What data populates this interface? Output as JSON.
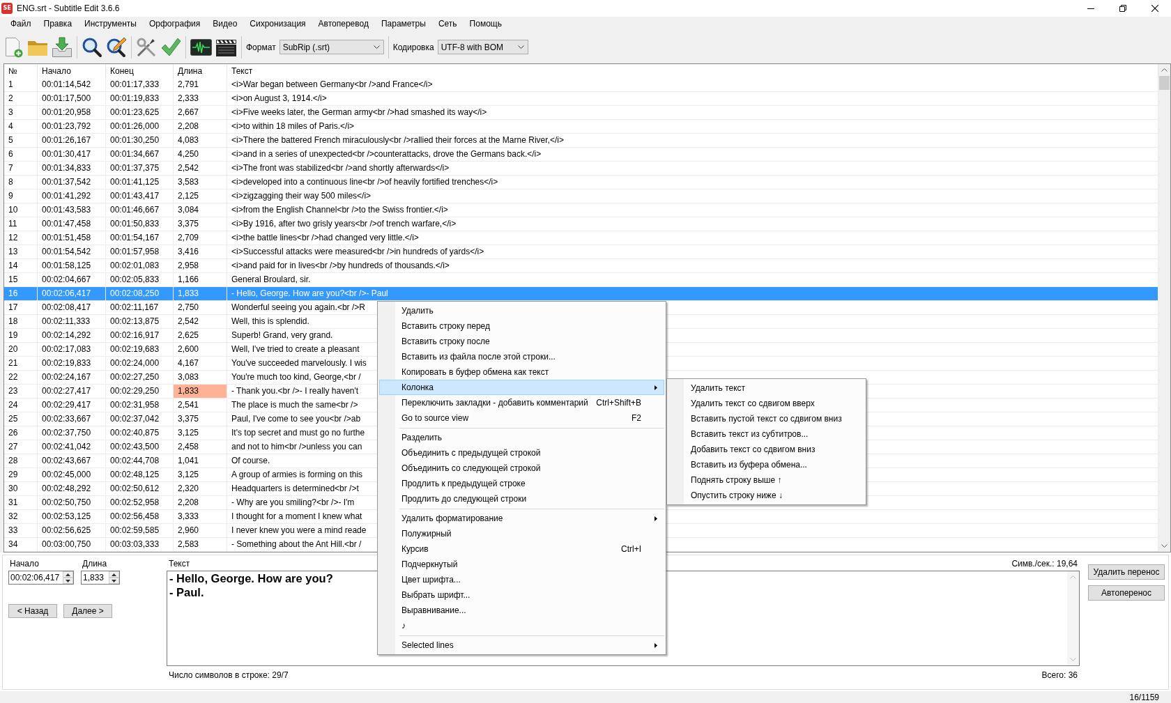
{
  "window": {
    "logo": "SE",
    "title": "ENG.srt - Subtitle Edit 3.6.6"
  },
  "menu_bar": {
    "items": [
      "Файл",
      "Правка",
      "Инструменты",
      "Орфография",
      "Видео",
      "Сихронизация",
      "Автоперевод",
      "Параметры",
      "Сеть",
      "Помощь"
    ]
  },
  "toolbar": {
    "format_label": "Формат",
    "format_value": "SubRip (.srt)",
    "encoding_label": "Кодировка",
    "encoding_value": "UTF-8 with BOM"
  },
  "subtitle_table": {
    "columns": [
      "№",
      "Начало",
      "Конец",
      "Длина",
      "Текст"
    ],
    "rows": [
      {
        "number": "1",
        "start": "00:01:14,542",
        "end": "00:01:17,333",
        "duration": "2,791",
        "text": "<i>War began between Germany<br />and France</i>",
        "selected": false,
        "duration_warning": false
      },
      {
        "number": "2",
        "start": "00:01:17,500",
        "end": "00:01:19,833",
        "duration": "2,333",
        "text": "<i>on August 3, 1914.</i>",
        "selected": false,
        "duration_warning": false
      },
      {
        "number": "3",
        "start": "00:01:20,958",
        "end": "00:01:23,625",
        "duration": "2,667",
        "text": "<i>Five weeks later, the German army<br />had smashed its way</i>",
        "selected": false,
        "duration_warning": false
      },
      {
        "number": "4",
        "start": "00:01:23,792",
        "end": "00:01:26,000",
        "duration": "2,208",
        "text": "<i>to within 18 miles of Paris.</i>",
        "selected": false,
        "duration_warning": false
      },
      {
        "number": "5",
        "start": "00:01:26,167",
        "end": "00:01:30,250",
        "duration": "4,083",
        "text": "<i>There the battered French miraculously<br />rallied their forces at the Marne River,</i>",
        "selected": false,
        "duration_warning": false
      },
      {
        "number": "6",
        "start": "00:01:30,417",
        "end": "00:01:34,667",
        "duration": "4,250",
        "text": "<i>and in a series of unexpected<br />counterattacks, drove the Germans back.</i>",
        "selected": false,
        "duration_warning": false
      },
      {
        "number": "7",
        "start": "00:01:34,833",
        "end": "00:01:37,375",
        "duration": "2,542",
        "text": "<i>The front was stabilized<br />and shortly afterwards</i>",
        "selected": false,
        "duration_warning": false
      },
      {
        "number": "8",
        "start": "00:01:37,542",
        "end": "00:01:41,125",
        "duration": "3,583",
        "text": "<i>developed into a continuous line<br />of heavily fortified trenches</i>",
        "selected": false,
        "duration_warning": false
      },
      {
        "number": "9",
        "start": "00:01:41,292",
        "end": "00:01:43,417",
        "duration": "2,125",
        "text": "<i>zigzagging their way 500 miles</i>",
        "selected": false,
        "duration_warning": false
      },
      {
        "number": "10",
        "start": "00:01:43,583",
        "end": "00:01:46,667",
        "duration": "3,084",
        "text": "<i>from the English Channel<br />to the Swiss frontier.</i>",
        "selected": false,
        "duration_warning": false
      },
      {
        "number": "11",
        "start": "00:01:47,458",
        "end": "00:01:50,833",
        "duration": "3,375",
        "text": "<i>By 1916, after two grisly years<br />of trench warfare,</i>",
        "selected": false,
        "duration_warning": false
      },
      {
        "number": "12",
        "start": "00:01:51,458",
        "end": "00:01:54,167",
        "duration": "2,709",
        "text": "<i>the battle lines<br />had changed very little.</i>",
        "selected": false,
        "duration_warning": false
      },
      {
        "number": "13",
        "start": "00:01:54,542",
        "end": "00:01:57,958",
        "duration": "3,416",
        "text": "<i>Successful attacks were measured<br />in hundreds of yards</i>",
        "selected": false,
        "duration_warning": false
      },
      {
        "number": "14",
        "start": "00:01:58,125",
        "end": "00:02:01,083",
        "duration": "2,958",
        "text": "<i>and paid for in lives<br />by hundreds of thousands.</i>",
        "selected": false,
        "duration_warning": false
      },
      {
        "number": "15",
        "start": "00:02:04,667",
        "end": "00:02:05,833",
        "duration": "1,166",
        "text": "General Broulard, sir.",
        "selected": false,
        "duration_warning": false
      },
      {
        "number": "16",
        "start": "00:02:06,417",
        "end": "00:02:08,250",
        "duration": "1,833",
        "text": "- Hello, George. How are you?<br />- Paul",
        "selected": true,
        "duration_warning": false
      },
      {
        "number": "17",
        "start": "00:02:08,417",
        "end": "00:02:11,167",
        "duration": "2,750",
        "text": "Wonderful seeing you again.<br />R",
        "selected": false,
        "duration_warning": false
      },
      {
        "number": "18",
        "start": "00:02:11,333",
        "end": "00:02:13,875",
        "duration": "2,542",
        "text": "Well, this is splendid.",
        "selected": false,
        "duration_warning": false
      },
      {
        "number": "19",
        "start": "00:02:14,292",
        "end": "00:02:16,917",
        "duration": "2,625",
        "text": "Superb! Grand, very grand.",
        "selected": false,
        "duration_warning": false
      },
      {
        "number": "20",
        "start": "00:02:17,083",
        "end": "00:02:19,683",
        "duration": "2,600",
        "text": "Well, I've tried to create a pleasant",
        "selected": false,
        "duration_warning": false
      },
      {
        "number": "21",
        "start": "00:02:19,833",
        "end": "00:02:24,000",
        "duration": "4,167",
        "text": "You've succeeded marvelously. I wis",
        "selected": false,
        "duration_warning": false
      },
      {
        "number": "22",
        "start": "00:02:24,167",
        "end": "00:02:27,250",
        "duration": "3,083",
        "text": "You're much too kind, George,<br /",
        "selected": false,
        "duration_warning": false
      },
      {
        "number": "23",
        "start": "00:02:27,417",
        "end": "00:02:29,250",
        "duration": "1,833",
        "text": "- Thank you.<br />- I really haven't",
        "selected": false,
        "duration_warning": true
      },
      {
        "number": "24",
        "start": "00:02:29,417",
        "end": "00:02:31,958",
        "duration": "2,541",
        "text": "The place is much the same<br />",
        "selected": false,
        "duration_warning": false
      },
      {
        "number": "25",
        "start": "00:02:33,667",
        "end": "00:02:37,042",
        "duration": "3,375",
        "text": "Paul, I've come to see you<br />ab",
        "selected": false,
        "duration_warning": false
      },
      {
        "number": "26",
        "start": "00:02:37,750",
        "end": "00:02:40,875",
        "duration": "3,125",
        "text": "It's top secret and must go no furthe",
        "selected": false,
        "duration_warning": false
      },
      {
        "number": "27",
        "start": "00:02:41,042",
        "end": "00:02:43,500",
        "duration": "2,458",
        "text": "and not to him<br />unless you can",
        "selected": false,
        "duration_warning": false
      },
      {
        "number": "28",
        "start": "00:02:43,667",
        "end": "00:02:44,708",
        "duration": "1,041",
        "text": "Of course.",
        "selected": false,
        "duration_warning": false
      },
      {
        "number": "29",
        "start": "00:02:45,000",
        "end": "00:02:48,125",
        "duration": "3,125",
        "text": "A group of armies is forming on this",
        "selected": false,
        "duration_warning": false
      },
      {
        "number": "30",
        "start": "00:02:48,292",
        "end": "00:02:50,612",
        "duration": "2,320",
        "text": "Headquarters is determined<br />t",
        "selected": false,
        "duration_warning": false
      },
      {
        "number": "31",
        "start": "00:02:50,750",
        "end": "00:02:52,958",
        "duration": "2,208",
        "text": "- Why are you smiling?<br />- I'm",
        "selected": false,
        "duration_warning": false
      },
      {
        "number": "32",
        "start": "00:02:53,125",
        "end": "00:02:56,458",
        "duration": "3,333",
        "text": "I thought for a moment I knew what",
        "selected": false,
        "duration_warning": false
      },
      {
        "number": "33",
        "start": "00:02:56,625",
        "end": "00:02:59,585",
        "duration": "2,960",
        "text": "I never knew you were a mind reade",
        "selected": false,
        "duration_warning": false
      },
      {
        "number": "34",
        "start": "00:03:00,750",
        "end": "00:03:03,333",
        "duration": "2,583",
        "text": "- Something about the Ant Hill.<br /",
        "selected": false,
        "duration_warning": false
      }
    ]
  },
  "edit_panel": {
    "start_label": "Начало",
    "start_value": "00:02:06,417",
    "duration_label": "Длина",
    "duration_value": "1,833",
    "previous_button": "< Назад",
    "next_button": "Далее >",
    "text_label": "Текст",
    "chars_per_second": "Симв./сек.: 19,64",
    "text_lines": [
      "- Hello, George. How are you?",
      "- Paul."
    ],
    "line_lengths": "Число символов в строке: 29/7",
    "total": "Всего: 36",
    "side_buttons": [
      "Удалить перенос",
      "Автоперенос"
    ]
  },
  "status_bar": {
    "position": "16/1159"
  },
  "context_menu": {
    "groups": [
      {
        "items": [
          {
            "label": "Удалить",
            "highlighted": false,
            "has_submenu": false
          },
          {
            "label": "Вставить строку перед",
            "highlighted": false,
            "has_submenu": false
          },
          {
            "label": "Вставить строку после",
            "highlighted": false,
            "has_submenu": false
          },
          {
            "label": "Вставить из файла после этой строки...",
            "highlighted": false,
            "has_submenu": false
          },
          {
            "label": "Копировать в буфер обмена как текст",
            "highlighted": false,
            "has_submenu": false
          },
          {
            "label": "Колонка",
            "highlighted": true,
            "has_submenu": true,
            "submenu": {
              "items": [
                "Удалить текст",
                "Удалить текст со сдвигом вверх",
                "Вставить пустой текст со сдвигом вниз",
                "Вставить текст из субтитров...",
                "Добавить текст со сдвигом вниз",
                "Вставить из буфера обмена...",
                "Поднять строку выше ↑",
                "Опустить строку ниже ↓"
              ]
            }
          },
          {
            "label": "Переключить закладки - добавить комментарий",
            "shortcut": "Ctrl+Shift+B",
            "highlighted": false,
            "has_submenu": false
          },
          {
            "label": "Go to source view",
            "shortcut": "F2",
            "highlighted": false,
            "has_submenu": false
          }
        ]
      },
      {
        "items": [
          {
            "label": "Разделить",
            "highlighted": false,
            "has_submenu": false
          },
          {
            "label": "Объединить с предыдущей строкой",
            "highlighted": false,
            "has_submenu": false
          },
          {
            "label": "Объединить со следующей строкой",
            "highlighted": false,
            "has_submenu": false
          },
          {
            "label": "Продлить к предыдущей строке",
            "highlighted": false,
            "has_submenu": false
          },
          {
            "label": "Продлить до следующей строки",
            "highlighted": false,
            "has_submenu": false
          }
        ]
      },
      {
        "items": [
          {
            "label": "Удалить форматирование",
            "highlighted": false,
            "has_submenu": true
          },
          {
            "label": "Полужирный",
            "highlighted": false,
            "has_submenu": false
          },
          {
            "label": "Курсив",
            "shortcut": "Ctrl+I",
            "highlighted": false,
            "has_submenu": false
          },
          {
            "label": "Подчеркнутый",
            "highlighted": false,
            "has_submenu": false
          },
          {
            "label": "Цвет шрифта...",
            "highlighted": false,
            "has_submenu": false
          },
          {
            "label": "Выбрать шрифт...",
            "highlighted": false,
            "has_submenu": false
          },
          {
            "label": "Выравнивание...",
            "highlighted": false,
            "has_submenu": false
          },
          {
            "label": "♪",
            "highlighted": false,
            "has_submenu": false
          }
        ]
      },
      {
        "items": [
          {
            "label": "Selected lines",
            "highlighted": false,
            "has_submenu": true
          }
        ]
      }
    ]
  }
}
